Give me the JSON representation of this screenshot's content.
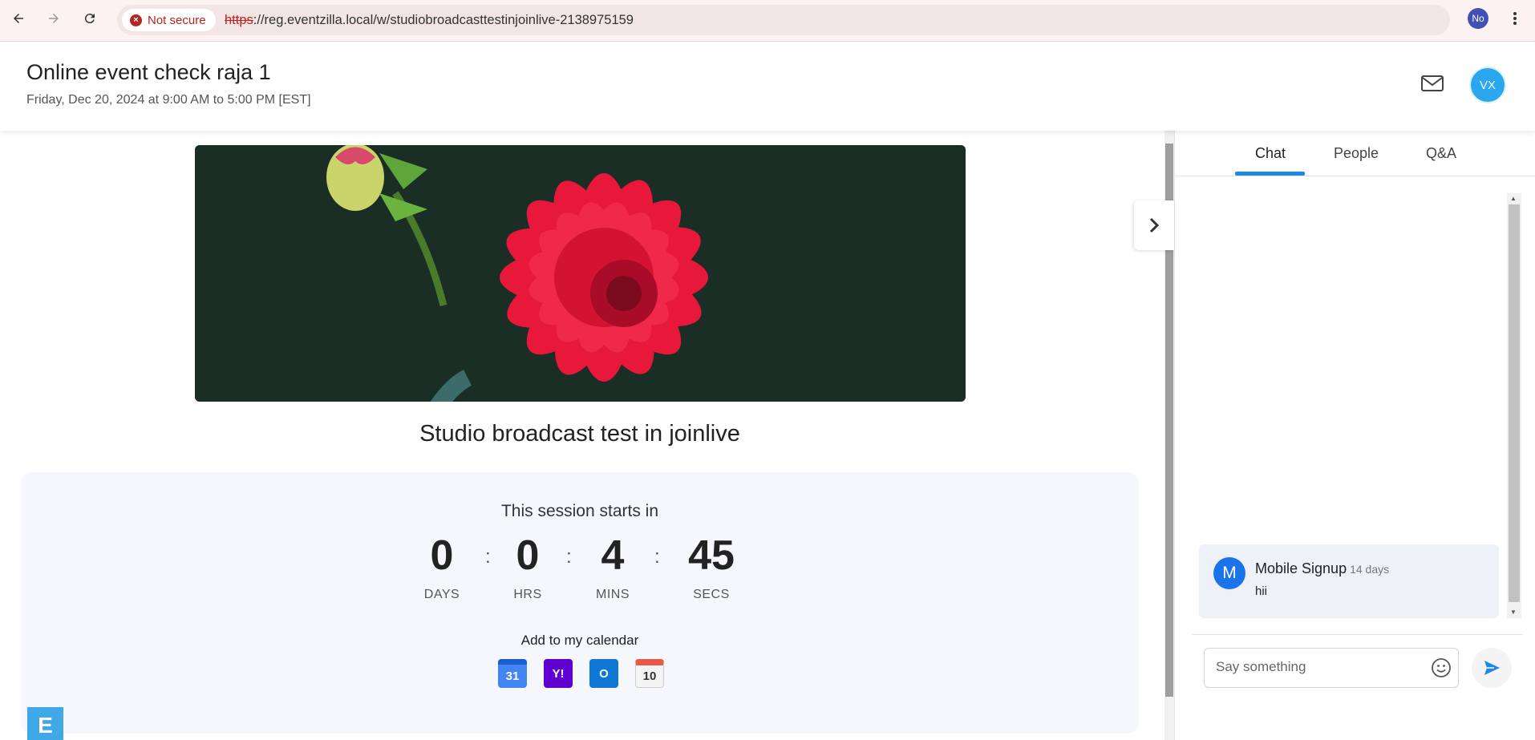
{
  "browser": {
    "security_label": "Not secure",
    "url_protocol": "https",
    "url_rest": "://reg.eventzilla.local/w/studiobroadcasttestinjoinlive-2138975159",
    "profile_initials": "No",
    "icons": [
      "back-icon",
      "forward-icon",
      "reload-icon",
      "bookmark-star-icon",
      "more-vert-icon"
    ]
  },
  "header": {
    "title": "Online event check raja 1",
    "date": "Friday, Dec 20, 2024 at 9:00 AM to 5:00 PM [EST]",
    "user_initials": "VX",
    "icons": [
      "mail-icon"
    ]
  },
  "main": {
    "session_title": "Studio broadcast test in joinlive",
    "countdown": {
      "heading": "This session starts in",
      "units": [
        {
          "value": "0",
          "label": "DAYS"
        },
        {
          "value": "0",
          "label": "HRS"
        },
        {
          "value": "4",
          "label": "MINS"
        },
        {
          "value": "45",
          "label": "SECS"
        }
      ],
      "separator": ":"
    },
    "calendar": {
      "label": "Add to my calendar",
      "items": [
        {
          "name": "google-calendar",
          "text": "31",
          "color": "#4285f4"
        },
        {
          "name": "yahoo-calendar",
          "text": "Y!",
          "color": "#6001d2"
        },
        {
          "name": "outlook-calendar",
          "text": "O",
          "color": "#0f78d4"
        },
        {
          "name": "ical-calendar",
          "text": "10",
          "color": "#f4f4f4"
        }
      ]
    },
    "brand_logo": "E"
  },
  "side": {
    "tabs": [
      "Chat",
      "People",
      "Q&A"
    ],
    "active_tab": "Chat",
    "messages": [
      {
        "initial": "M",
        "name": "Mobile Signup",
        "time": "14 days",
        "text": "hii"
      }
    ],
    "composer_placeholder": "Say something"
  },
  "colors": {
    "accent": "#1e88e5",
    "avatar": "#29a8f0",
    "not_secure": "#b3261e"
  }
}
